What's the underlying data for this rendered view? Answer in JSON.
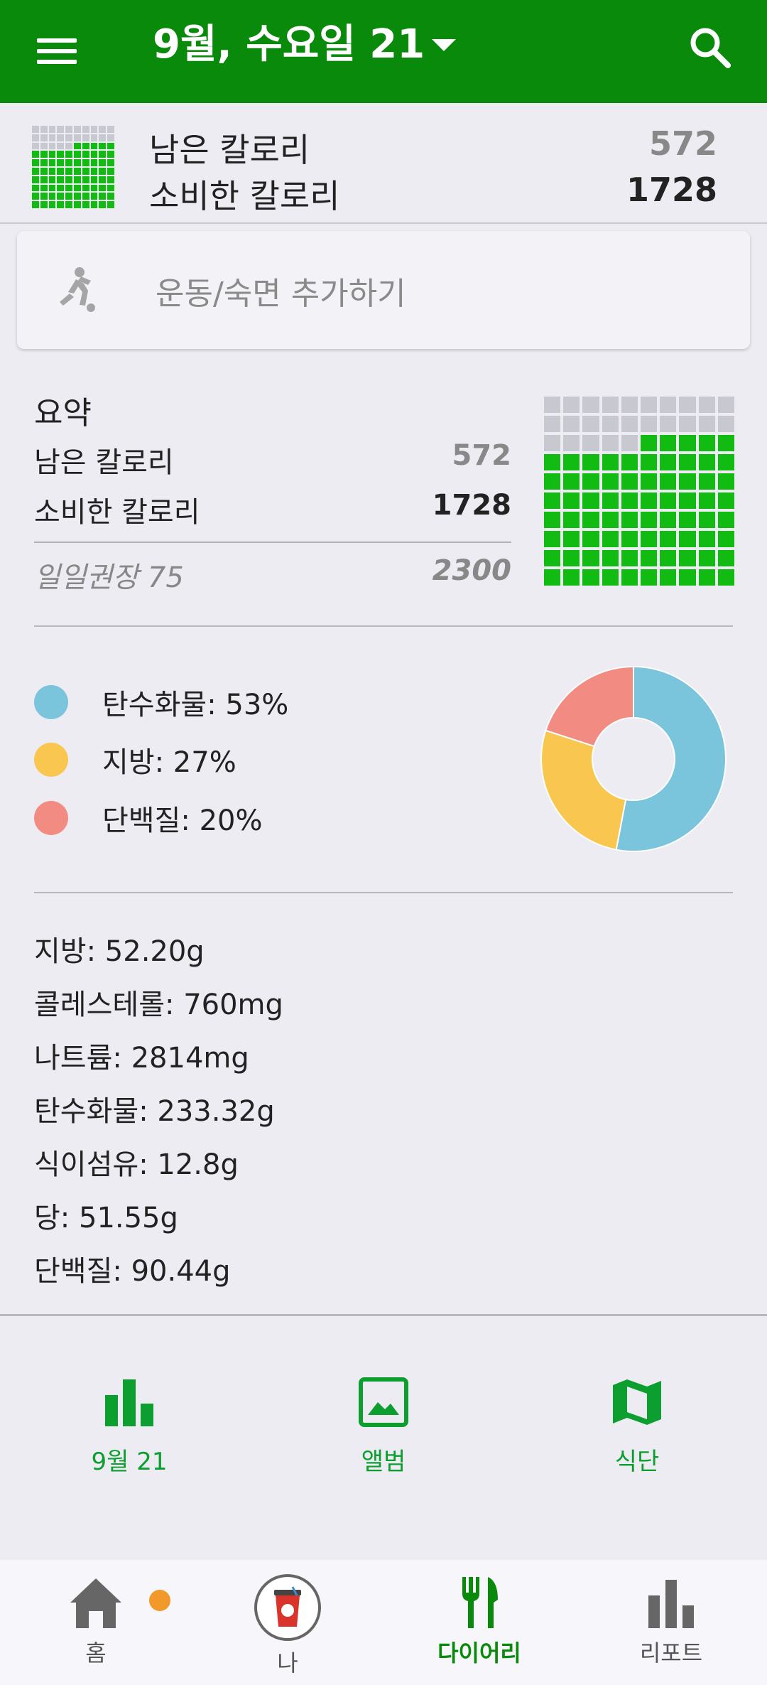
{
  "header": {
    "title": "9월, 수요일 21"
  },
  "calorie_bar": {
    "remaining_label": "남은 칼로리",
    "remaining_value": "572",
    "consumed_label": "소비한 칼로리",
    "consumed_value": "1728"
  },
  "add_activity": {
    "label": "운동/숙면 추가하기"
  },
  "summary": {
    "title": "요약",
    "remaining_label": "남은 칼로리",
    "remaining_value": "572",
    "consumed_label": "소비한 칼로리",
    "consumed_value": "1728",
    "daily_label": "일일권장 75",
    "daily_value": "2300",
    "grid_filled_fraction": 0.752
  },
  "macros": [
    {
      "label": "탄수화물: 53%",
      "percent": 53,
      "color": "#7ac4dc"
    },
    {
      "label": "지방: 27%",
      "percent": 27,
      "color": "#f9c74f"
    },
    {
      "label": "단백질: 20%",
      "percent": 20,
      "color": "#f28b82"
    }
  ],
  "nutrients": [
    "지방: 52.20g",
    "콜레스테롤: 760mg",
    "나트륨: 2814mg",
    "탄수화물: 233.32g",
    "식이섬유: 12.8g",
    "당: 51.55g",
    "단백질: 90.44g"
  ],
  "shortcuts": {
    "date": "9월 21",
    "album": "앨범",
    "meal_plan": "식단"
  },
  "bottom_nav": {
    "home": "홈",
    "me": "나",
    "diary": "다이어리",
    "report": "리포트"
  },
  "colors": {
    "brand": "#0a8a0a",
    "accent_green": "#0c9e2e",
    "grid_green": "#11bb11",
    "badge": "#f19a2a"
  }
}
